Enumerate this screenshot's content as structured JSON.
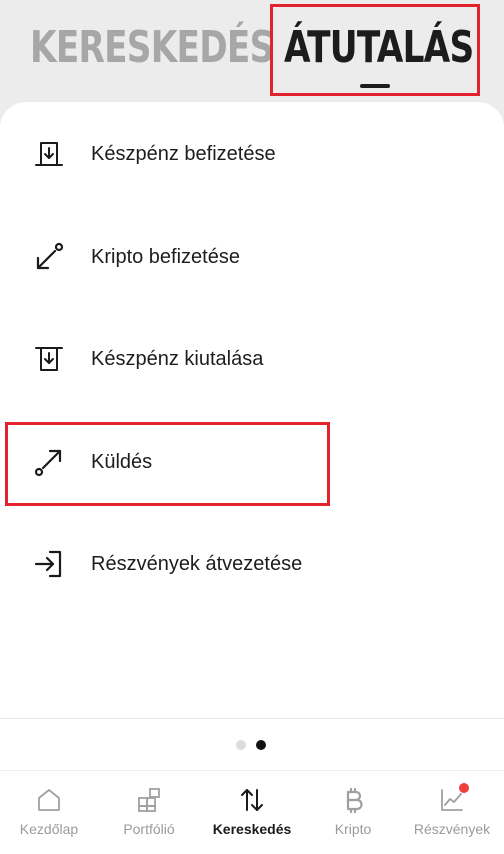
{
  "header": {
    "tabs": [
      {
        "label": "KERESKEDÉS",
        "active": false
      },
      {
        "label": "ÁTUTALÁS",
        "active": true
      }
    ]
  },
  "menu": {
    "items": [
      {
        "label": "Készpénz befizetése",
        "icon": "cash-deposit-icon"
      },
      {
        "label": "Kripto befizetése",
        "icon": "crypto-deposit-icon"
      },
      {
        "label": "Készpénz kiutalása",
        "icon": "cash-withdraw-icon"
      },
      {
        "label": "Küldés",
        "icon": "send-icon"
      },
      {
        "label": "Részvények átvezetése",
        "icon": "transfer-stocks-icon"
      }
    ]
  },
  "pager": {
    "count": 2,
    "active_index": 1
  },
  "nav": {
    "items": [
      {
        "label": "Kezdőlap",
        "icon": "home-icon"
      },
      {
        "label": "Portfólió",
        "icon": "portfolio-icon"
      },
      {
        "label": "Kereskedés",
        "icon": "trade-arrows-icon",
        "active": true
      },
      {
        "label": "Kripto",
        "icon": "bitcoin-icon"
      },
      {
        "label": "Részvények",
        "icon": "stocks-chart-icon",
        "badge": true
      }
    ]
  },
  "colors": {
    "highlight": "#e2222d",
    "badge": "#ee3b3b",
    "inactive_text": "#a7a7a7"
  }
}
